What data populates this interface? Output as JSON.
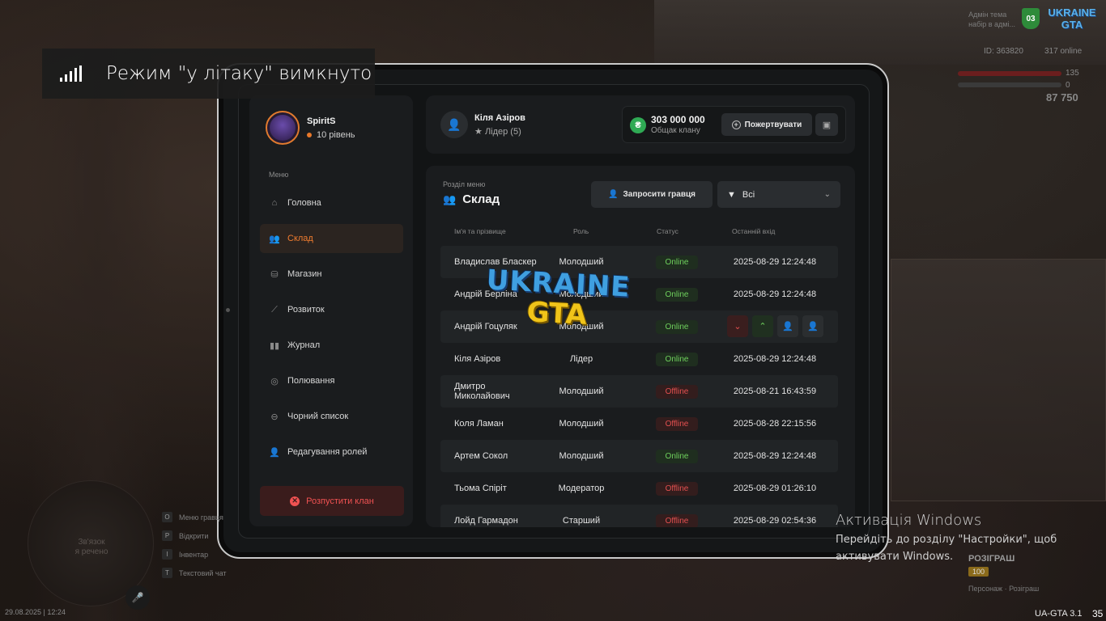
{
  "notification": {
    "text": "Режим \"у літаку\" вимкнуто"
  },
  "hud": {
    "id": "ID: 363820",
    "online": "317 online",
    "health": "135",
    "armor": "0",
    "money": "87 750",
    "server_logo": "UKRAINE GTA",
    "badge": "03",
    "mini_note": "Адмін тема\nнабір в адмі..."
  },
  "profile": {
    "name": "SpiritS",
    "level": "10 рівень"
  },
  "menu": {
    "title": "Меню",
    "items": [
      {
        "label": "Головна",
        "icon": "home-icon"
      },
      {
        "label": "Склад",
        "icon": "members-icon"
      },
      {
        "label": "Магазин",
        "icon": "basket-icon"
      },
      {
        "label": "Розвиток",
        "icon": "chart-icon"
      },
      {
        "label": "Журнал",
        "icon": "book-icon"
      },
      {
        "label": "Полювання",
        "icon": "target-icon"
      },
      {
        "label": "Чорний список",
        "icon": "block-icon"
      },
      {
        "label": "Редагування ролей",
        "icon": "user-edit-icon"
      }
    ],
    "disband": "Розпустити клан"
  },
  "header": {
    "leader_name": "Кіля Азіров",
    "leader_role": "Лідер (5)",
    "bank_amount": "303 000 000",
    "bank_label": "Общак клану",
    "donate_label": "Пожертвувати"
  },
  "section": {
    "subtitle": "Розділ меню",
    "title": "Склад",
    "invite_label": "Запросити гравця",
    "filter_value": "Всі"
  },
  "table": {
    "headers": {
      "name": "Ім'я та прізвище",
      "role": "Роль",
      "status": "Статус",
      "last": "Останній вхід"
    },
    "rows": [
      {
        "name": "Владислав Бласкер",
        "role": "Молодший",
        "status": "Online",
        "last": "2025-08-29 12:24:48"
      },
      {
        "name": "Андрій Берліна",
        "role": "Молодший",
        "status": "Online",
        "last": "2025-08-29 12:24:48"
      },
      {
        "name": "Андрій Гоцуляк",
        "role": "Молодший",
        "status": "Online",
        "last": ""
      },
      {
        "name": "Кіля Азіров",
        "role": "Лідер",
        "status": "Online",
        "last": "2025-08-29 12:24:48"
      },
      {
        "name": "Дмитро Миколайович",
        "role": "Молодший",
        "status": "Offline",
        "last": "2025-08-21 16:43:59"
      },
      {
        "name": "Коля Ламан",
        "role": "Молодший",
        "status": "Offline",
        "last": "2025-08-28 22:15:56"
      },
      {
        "name": "Артем Сокол",
        "role": "Молодший",
        "status": "Online",
        "last": "2025-08-29 12:24:48"
      },
      {
        "name": "Тьома Спіріт",
        "role": "Модератор",
        "status": "Offline",
        "last": "2025-08-29 01:26:10"
      },
      {
        "name": "Лойд Гармадон",
        "role": "Старший",
        "status": "Offline",
        "last": "2025-08-29 02:54:36"
      }
    ]
  },
  "minimap": {
    "text": "Зв'язок\nя речено"
  },
  "keys": [
    {
      "key": "O",
      "label": "Меню гравця"
    },
    {
      "key": "P",
      "label": "Відкрити"
    },
    {
      "key": "I",
      "label": "Інвентар"
    },
    {
      "key": "T",
      "label": "Текстовий чат"
    }
  ],
  "datetime": "29.08.2025 | 12:24",
  "windows": {
    "title": "Активація Windows",
    "line1": "Перейдіть до розділу \"Настройки\", щоб",
    "line2": "активувати Windows."
  },
  "promo": {
    "title": "РОЗІГРАШ",
    "badge": "100",
    "sub": "Персонаж · Розіграш"
  },
  "game_version": "UA-GTA 3.1",
  "corner_number": "35",
  "colors": {
    "accent": "#f07c2f",
    "online": "#6fd15d",
    "offline": "#e45050"
  }
}
